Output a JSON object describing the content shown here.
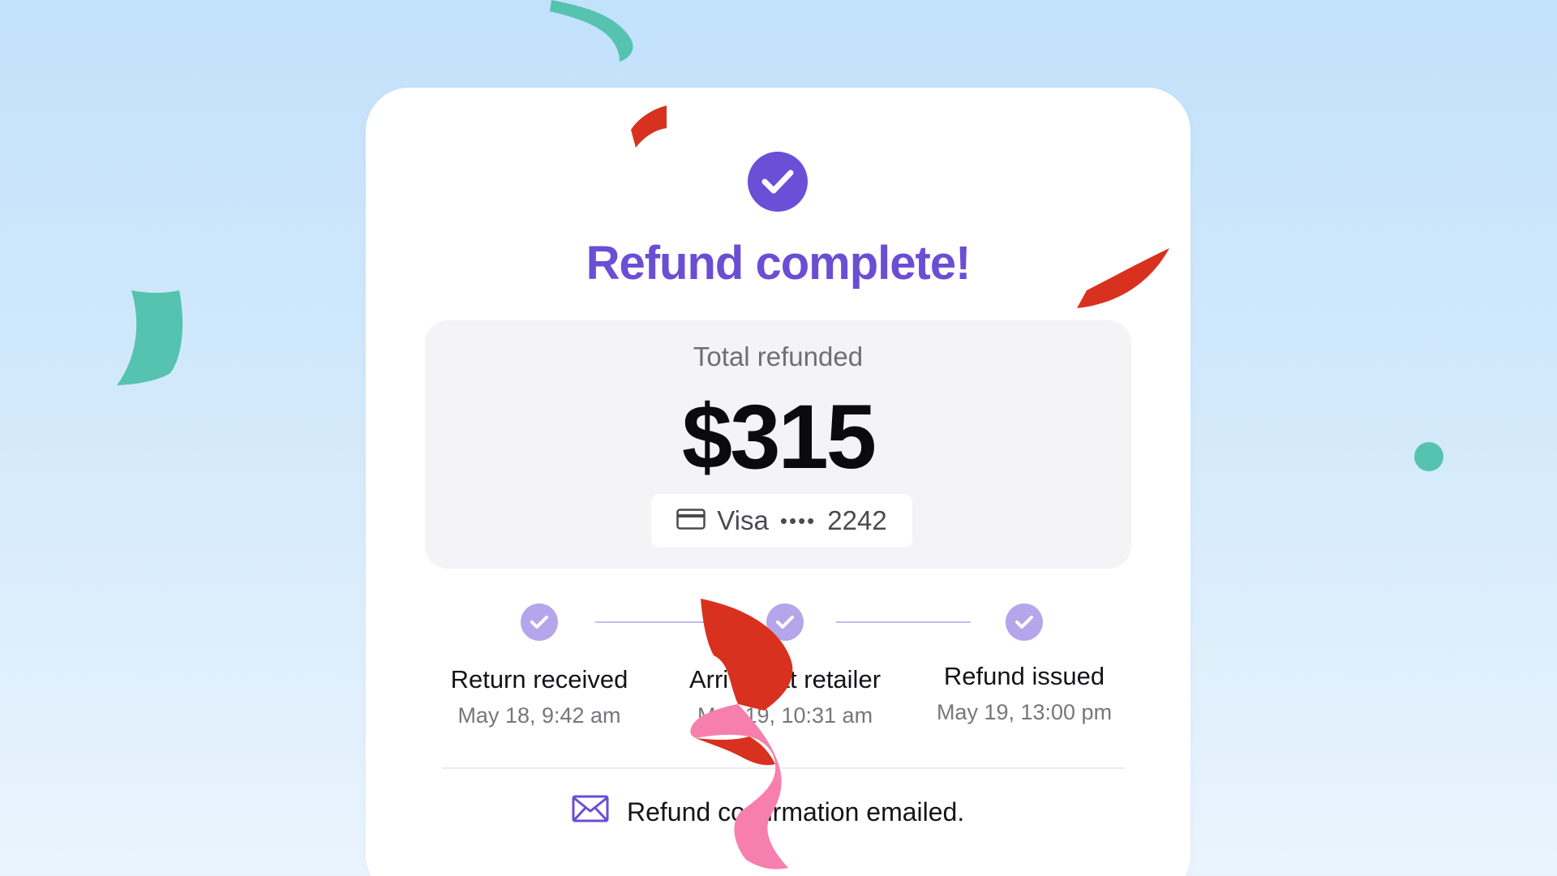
{
  "header": {
    "title": "Refund complete!"
  },
  "summary": {
    "label": "Total refunded",
    "amount": "$315",
    "payment_brand": "Visa",
    "masked_dots": "••••",
    "last4": "2242"
  },
  "steps": [
    {
      "title": "Return received",
      "time": "May 18, 9:42 am",
      "status": "complete"
    },
    {
      "title": "Arrived at retailer",
      "time": "May 19, 10:31 am",
      "status": "complete"
    },
    {
      "title": "Refund issued",
      "time": "May 19, 13:00 pm",
      "status": "complete"
    }
  ],
  "footer": {
    "message": "Refund confirmation emailed."
  },
  "colors": {
    "accent": "#6b4fd6",
    "step_dot": "#b3a6ea",
    "confetti_red": "#d9311f",
    "confetti_teal": "#55c3b0",
    "confetti_pink": "#f77fae"
  },
  "icons": {
    "success": "check-circle-icon",
    "step": "check-icon",
    "payment": "credit-card-icon",
    "email": "envelope-icon"
  }
}
